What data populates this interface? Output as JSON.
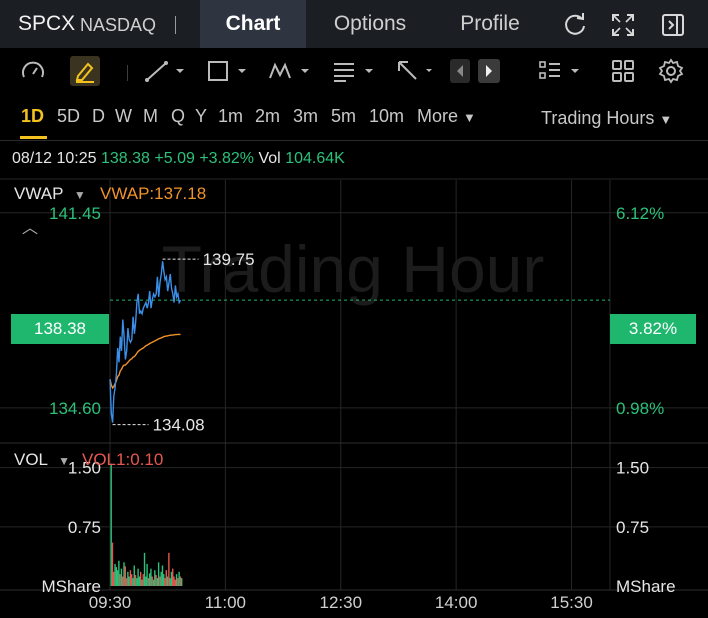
{
  "header": {
    "symbol": "SPCX",
    "exchange": "NASDAQ",
    "tabs": [
      {
        "label": "Chart",
        "active": true
      },
      {
        "label": "Options",
        "active": false
      },
      {
        "label": "Profile",
        "active": false
      }
    ],
    "icons": [
      "refresh-icon",
      "expand-icon",
      "sidebar-toggle-icon"
    ]
  },
  "toolbar": {
    "icons": [
      "speedometer-icon",
      "pencil-draw-icon",
      "trend-line-icon",
      "rectangle-icon",
      "pattern-icon",
      "text-lines-icon",
      "arrow-icon",
      "arrow-left-icon",
      "arrow-right-icon",
      "list-icon",
      "grid-icon",
      "settings-icon"
    ],
    "active_icon": "pencil-draw-icon",
    "accent": "#f4c21e"
  },
  "timeframes": {
    "items": [
      "1D",
      "5D",
      "D",
      "W",
      "M",
      "Q",
      "Y",
      "1m",
      "2m",
      "3m",
      "5m",
      "10m"
    ],
    "active": "1D",
    "more_label": "More",
    "trading_hours_label": "Trading Hours"
  },
  "quote": {
    "datetime": "08/12 10:25",
    "price": "138.38",
    "change": "+5.09",
    "change_pct": "+3.82%",
    "vol_label": "Vol",
    "vol_value": "104.64K"
  },
  "price_panel": {
    "indicator_name": "VWAP",
    "indicator_value": "VWAP:137.18",
    "watermark": "Trading Hour",
    "left_labels": {
      "top": "141.45",
      "current": "138.38",
      "bottom": "134.60"
    },
    "right_labels": {
      "top": "6.12%",
      "current": "3.82%",
      "bottom": "0.98%"
    },
    "high_annotation": "139.75",
    "low_annotation": "134.08"
  },
  "volume_panel": {
    "indicator_name": "VOL",
    "indicator_value": "VOL1:0.10",
    "left_labels": {
      "top": "1.50",
      "mid": "0.75",
      "unit": "MShare"
    },
    "right_labels": {
      "top": "1.50",
      "mid": "0.75",
      "unit": "MShare"
    }
  },
  "time_axis": [
    "09:30",
    "11:00",
    "12:30",
    "14:00",
    "15:30"
  ],
  "colors": {
    "up": "#2bc17a",
    "down": "#e8574f",
    "vwap": "#f0932b",
    "price_line": "#3b8fe8",
    "badge": "#1fb66e",
    "active_tab_bg": "#2e3440"
  },
  "chart_data": {
    "type": "line",
    "price": {
      "x": [
        "09:30",
        "09:31",
        "09:32",
        "09:33",
        "09:34",
        "09:35",
        "09:36",
        "09:37",
        "09:38",
        "09:39",
        "09:40",
        "09:41",
        "09:42",
        "09:43",
        "09:44",
        "09:45",
        "09:46",
        "09:47",
        "09:48",
        "09:49",
        "09:50",
        "09:51",
        "09:52",
        "09:53",
        "09:54",
        "09:55",
        "09:56",
        "09:57",
        "09:58",
        "09:59",
        "10:00",
        "10:01",
        "10:02",
        "10:03",
        "10:04",
        "10:05",
        "10:06",
        "10:07",
        "10:08",
        "10:09",
        "10:10",
        "10:11",
        "10:12",
        "10:13",
        "10:14",
        "10:15",
        "10:16",
        "10:17",
        "10:18",
        "10:19",
        "10:20",
        "10:21",
        "10:22",
        "10:23",
        "10:24",
        "10:25"
      ],
      "values": [
        135.6,
        134.4,
        134.08,
        135.0,
        135.3,
        135.8,
        136.7,
        136.2,
        137.1,
        136.6,
        137.7,
        137.1,
        136.3,
        136.6,
        137.4,
        137.0,
        136.9,
        137.0,
        137.8,
        137.2,
        137.6,
        138.3,
        138.6,
        137.9,
        138.0,
        137.9,
        138.1,
        138.2,
        138.3,
        138.1,
        138.3,
        138.7,
        138.1,
        138.4,
        138.6,
        138.5,
        138.6,
        139.2,
        138.5,
        139.0,
        139.3,
        139.75,
        139.4,
        139.1,
        139.2,
        138.7,
        139.0,
        139.3,
        138.8,
        138.6,
        138.3,
        138.9,
        138.5,
        138.6,
        138.3,
        138.38
      ]
    },
    "vwap_series": [
      135.6,
      135.4,
      135.3,
      135.35,
      135.45,
      135.55,
      135.7,
      135.75,
      135.9,
      135.95,
      136.05,
      136.1,
      136.1,
      136.15,
      136.2,
      136.25,
      136.3,
      136.32,
      136.38,
      136.4,
      136.45,
      136.52,
      136.58,
      136.62,
      136.65,
      136.68,
      136.7,
      136.74,
      136.78,
      136.8,
      136.83,
      136.86,
      136.88,
      136.9,
      136.93,
      136.95,
      136.97,
      137.0,
      137.02,
      137.04,
      137.06,
      137.08,
      137.1,
      137.11,
      137.12,
      137.13,
      137.14,
      137.15,
      137.15,
      137.16,
      137.16,
      137.17,
      137.17,
      137.18,
      137.18,
      137.18
    ],
    "volume": {
      "values_mshare": [
        1.55,
        0.55,
        0.18,
        0.28,
        0.24,
        0.2,
        0.32,
        0.15,
        0.22,
        0.12,
        0.3,
        0.25,
        0.1,
        0.18,
        0.12,
        0.2,
        0.15,
        0.1,
        0.26,
        0.14,
        0.1,
        0.22,
        0.12,
        0.18,
        0.08,
        0.15,
        0.42,
        0.12,
        0.28,
        0.1,
        0.16,
        0.22,
        0.12,
        0.08,
        0.2,
        0.14,
        0.1,
        0.3,
        0.12,
        0.18,
        0.26,
        0.15,
        0.1,
        0.2,
        0.12,
        0.42,
        0.1,
        0.18,
        0.22,
        0.12,
        0.08,
        0.15,
        0.1,
        0.18,
        0.12,
        0.1
      ],
      "up": [
        1,
        0,
        0,
        1,
        1,
        1,
        1,
        0,
        1,
        0,
        1,
        0,
        0,
        1,
        1,
        0,
        0,
        1,
        1,
        0,
        1,
        1,
        1,
        0,
        1,
        0,
        1,
        1,
        1,
        0,
        1,
        1,
        0,
        1,
        1,
        0,
        1,
        1,
        0,
        1,
        1,
        1,
        0,
        0,
        1,
        0,
        1,
        1,
        0,
        0,
        0,
        1,
        0,
        1,
        0,
        1
      ]
    },
    "price_range": [
      133.4,
      142.6
    ],
    "volume_range": [
      0,
      1.8
    ],
    "grid": true
  }
}
